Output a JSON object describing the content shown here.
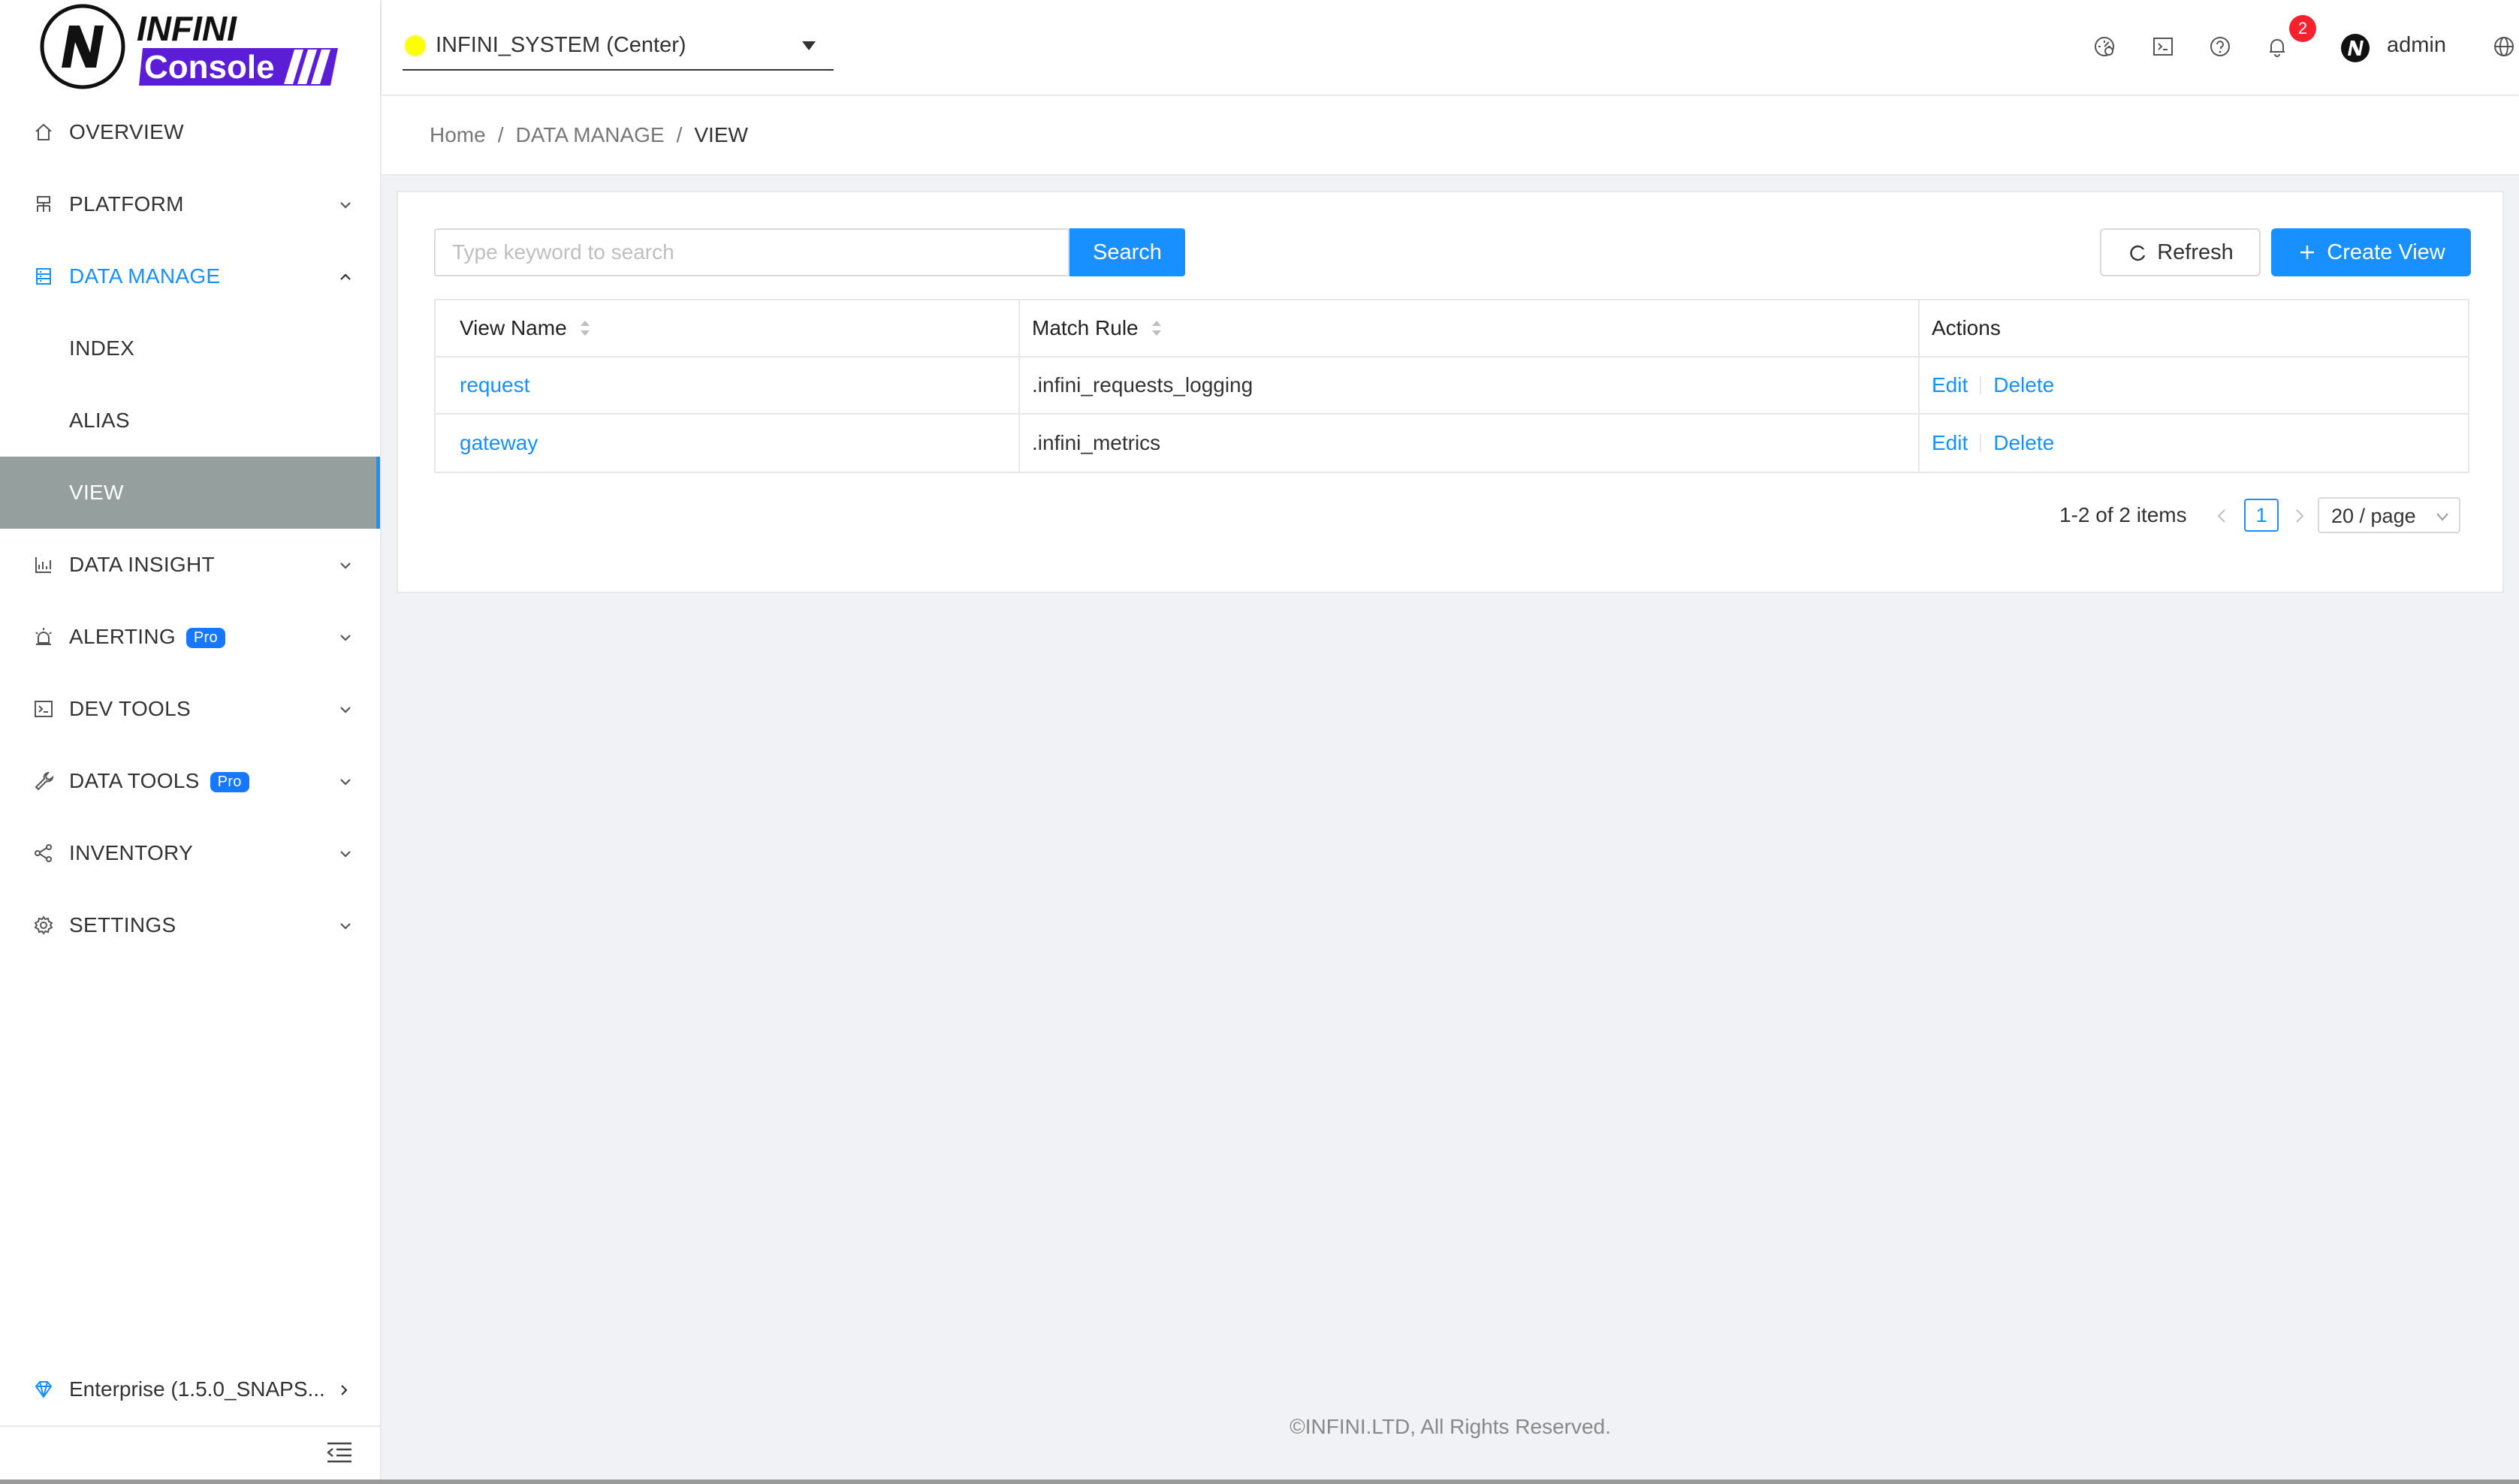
{
  "app": {
    "logo_text_top": "INFINI",
    "logo_text_bottom": "Console"
  },
  "header": {
    "cluster_name": "INFINI_SYSTEM (Center)",
    "cluster_status_color": "#ffff00",
    "notification_count": "2",
    "user_name": "admin",
    "icons": [
      "dashboard-icon",
      "terminal-icon",
      "help-icon",
      "bell-icon",
      "avatar",
      "globe-icon"
    ]
  },
  "sidebar": {
    "items": [
      {
        "label": "OVERVIEW",
        "icon": "home-icon"
      },
      {
        "label": "PLATFORM",
        "icon": "platform-icon"
      },
      {
        "label": "DATA MANAGE",
        "icon": "database-icon"
      },
      {
        "label": "INDEX"
      },
      {
        "label": "ALIAS"
      },
      {
        "label": "VIEW"
      },
      {
        "label": "DATA INSIGHT",
        "icon": "chart-icon"
      },
      {
        "label": "ALERTING",
        "icon": "alarm-icon",
        "badge": "Pro"
      },
      {
        "label": "DEV TOOLS",
        "icon": "terminal-icon"
      },
      {
        "label": "DATA TOOLS",
        "icon": "wrench-icon",
        "badge": "Pro"
      },
      {
        "label": "INVENTORY",
        "icon": "share-icon"
      },
      {
        "label": "SETTINGS",
        "icon": "gear-icon"
      }
    ],
    "footer_label": "Enterprise (1.5.0_SNAPS...",
    "accent_color": "#1890ff"
  },
  "breadcrumb": {
    "home": "Home",
    "section": "DATA MANAGE",
    "current": "VIEW"
  },
  "toolbar": {
    "search_placeholder": "Type keyword to search",
    "search_label": "Search",
    "refresh_label": "Refresh",
    "create_label": "Create View"
  },
  "table": {
    "columns": [
      "View Name",
      "Match Rule",
      "Actions"
    ],
    "rows": [
      {
        "name": "request",
        "rule": ".infini_requests_logging",
        "edit": "Edit",
        "delete": "Delete"
      },
      {
        "name": "gateway",
        "rule": ".infini_metrics",
        "edit": "Edit",
        "delete": "Delete"
      }
    ]
  },
  "pagination": {
    "total": "1-2 of 2 items",
    "current_page": "1",
    "page_size": "20 / page"
  },
  "footer": {
    "copyright": "©INFINI.LTD, All Rights Reserved."
  }
}
